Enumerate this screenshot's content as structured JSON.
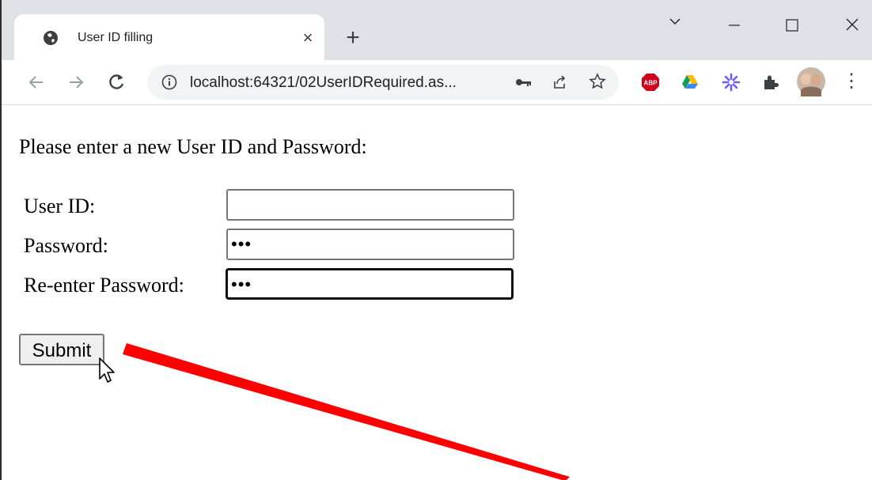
{
  "tab": {
    "title": "User ID filling",
    "close": "×",
    "new_tab": "+"
  },
  "window_controls": {
    "dropdown": "⌄",
    "minimize": "–",
    "maximize": "☐",
    "close": "✕"
  },
  "toolbar": {
    "url": "localhost:64321/02UserIDRequired.as...",
    "abp_label": "ABP",
    "menu": "⋮"
  },
  "form": {
    "prompt": "Please enter a new User ID and Password:",
    "userid_label": "User ID:",
    "userid_value": "",
    "password_label": "Password:",
    "password_value": "•••",
    "reenter_label": "Re-enter Password:",
    "reenter_value": "•••",
    "submit_label": "Submit"
  },
  "colors": {
    "annotation_arrow": "#ff0000",
    "tabstrip": "#dee1e6",
    "abp": "#d0021b"
  }
}
